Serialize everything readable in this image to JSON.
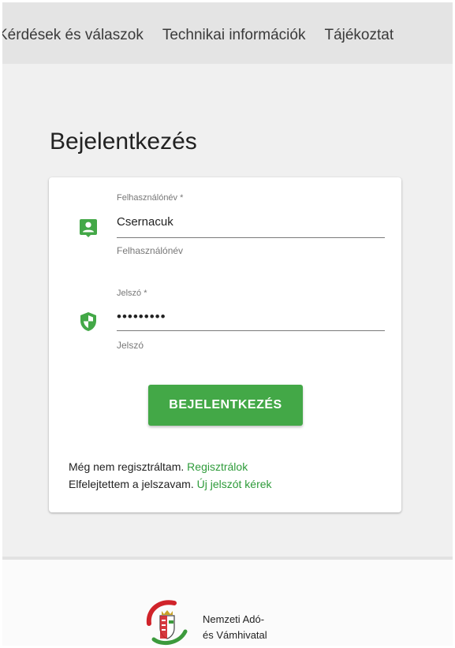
{
  "topnav": {
    "items": [
      "Kérdések és válaszok",
      "Technikai információk",
      "Tájékoztat"
    ]
  },
  "page": {
    "title": "Bejelentkezés"
  },
  "login_form": {
    "username": {
      "label": "Felhasználónév *",
      "value": "Csernacuk",
      "help": "Felhasználónév",
      "icon": "account-box-icon"
    },
    "password": {
      "label": "Jelszó *",
      "value": "•••••••••",
      "help": "Jelszó",
      "icon": "shield-icon"
    },
    "submit_label": "BEJELENTKEZÉS",
    "register": {
      "text": "Még nem regisztráltam.",
      "link": "Regisztrálok"
    },
    "forgot": {
      "text": "Elfelejtettem a jelszavam.",
      "link": "Új jelszót kérek"
    }
  },
  "footer": {
    "org_line1": "Nemzeti Adó-",
    "org_line2": "és Vámhivatal",
    "logo_icon": "nav-crest-logo"
  },
  "colors": {
    "accent": "#43a847",
    "link": "#2e9b3a",
    "nav_bg": "#e4e4e4",
    "page_bg": "#f0f0f0",
    "logo_red": "#d0232a",
    "logo_green": "#3c9a3c"
  }
}
